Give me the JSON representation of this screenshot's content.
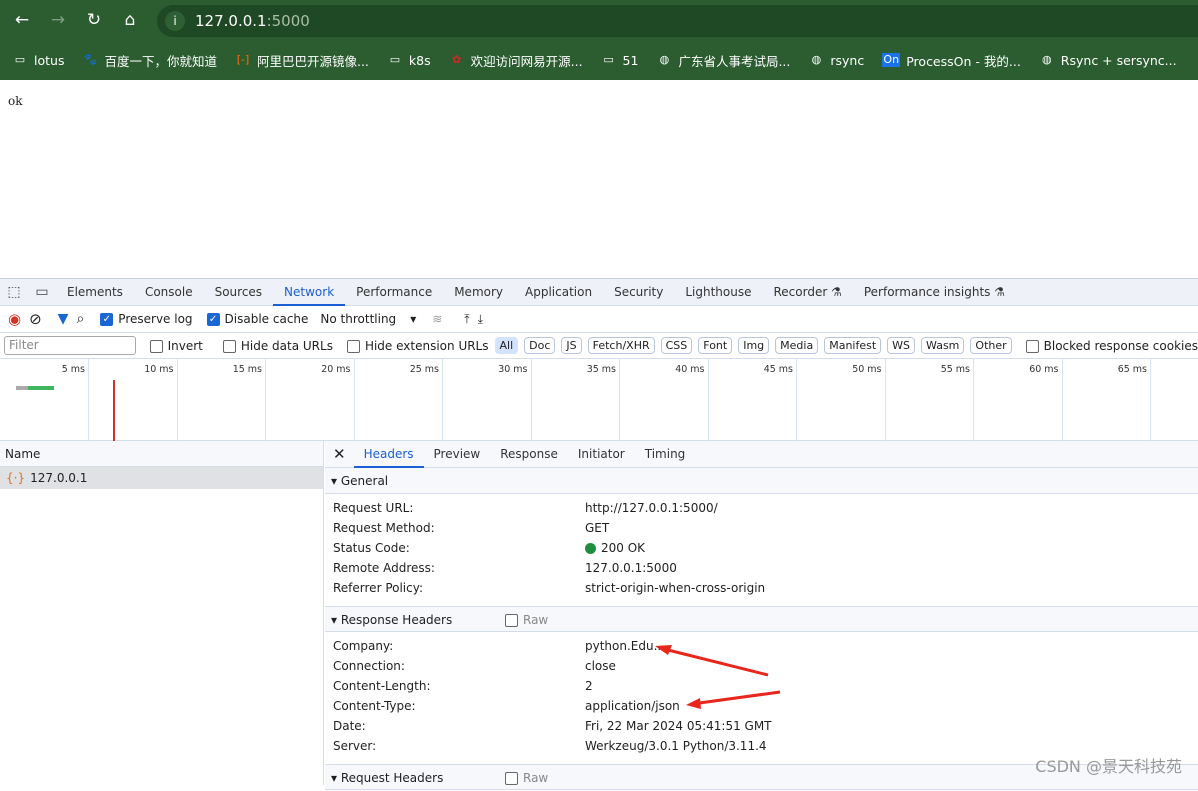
{
  "browser": {
    "url_host": "127.0.0.1",
    "url_port": ":5000",
    "bookmarks": [
      {
        "icon": "folder-icon",
        "label": "lotus"
      },
      {
        "icon": "baidu-icon",
        "label": "百度一下，你就知道"
      },
      {
        "icon": "aliyun-icon",
        "label": "阿里巴巴开源镜像..."
      },
      {
        "icon": "folder-icon",
        "label": "k8s"
      },
      {
        "icon": "netease-icon",
        "label": "欢迎访问网易开源..."
      },
      {
        "icon": "folder-icon",
        "label": "51"
      },
      {
        "icon": "globe-icon",
        "label": "广东省人事考试局..."
      },
      {
        "icon": "globe-icon",
        "label": "rsync"
      },
      {
        "icon": "processon-icon",
        "label": "ProcessOn - 我的..."
      },
      {
        "icon": "globe-icon",
        "label": "Rsync + sersync..."
      }
    ]
  },
  "page": {
    "body_text": "ok"
  },
  "devtools": {
    "tabs": [
      "Elements",
      "Console",
      "Sources",
      "Network",
      "Performance",
      "Memory",
      "Application",
      "Security",
      "Lighthouse",
      "Recorder ⚗",
      "Performance insights ⚗"
    ],
    "active_tab": "Network",
    "toolbar": {
      "preserve_log": "Preserve log",
      "preserve_log_checked": true,
      "disable_cache": "Disable cache",
      "disable_cache_checked": true,
      "throttling": "No throttling"
    },
    "filter": {
      "placeholder": "Filter",
      "invert": "Invert",
      "hide_data_urls": "Hide data URLs",
      "hide_extension_urls": "Hide extension URLs",
      "types": [
        "All",
        "Doc",
        "JS",
        "Fetch/XHR",
        "CSS",
        "Font",
        "Img",
        "Media",
        "Manifest",
        "WS",
        "Wasm",
        "Other"
      ],
      "blocked": "Blocked response cookies"
    },
    "timeline_ticks": [
      "5 ms",
      "10 ms",
      "15 ms",
      "20 ms",
      "25 ms",
      "30 ms",
      "35 ms",
      "40 ms",
      "45 ms",
      "50 ms",
      "55 ms",
      "60 ms",
      "65 ms"
    ],
    "name_header": "Name",
    "requests": [
      {
        "name": "127.0.0.1"
      }
    ],
    "detail_tabs": [
      "Headers",
      "Preview",
      "Response",
      "Initiator",
      "Timing"
    ],
    "general": {
      "title": "General",
      "rows": [
        {
          "k": "Request URL:",
          "v": "http://127.0.0.1:5000/"
        },
        {
          "k": "Request Method:",
          "v": "GET"
        },
        {
          "k": "Status Code:",
          "v": "200 OK"
        },
        {
          "k": "Remote Address:",
          "v": "127.0.0.1:5000"
        },
        {
          "k": "Referrer Policy:",
          "v": "strict-origin-when-cross-origin"
        }
      ]
    },
    "response_headers": {
      "title": "Response Headers",
      "raw": "Raw",
      "rows": [
        {
          "k": "Company:",
          "v": "python.Edu..."
        },
        {
          "k": "Connection:",
          "v": "close"
        },
        {
          "k": "Content-Length:",
          "v": "2"
        },
        {
          "k": "Content-Type:",
          "v": "application/json"
        },
        {
          "k": "Date:",
          "v": "Fri, 22 Mar 2024 05:41:51 GMT"
        },
        {
          "k": "Server:",
          "v": "Werkzeug/3.0.1 Python/3.11.4"
        }
      ]
    },
    "request_headers": {
      "title": "Request Headers",
      "raw": "Raw"
    }
  },
  "watermark": "CSDN @景天科技苑"
}
